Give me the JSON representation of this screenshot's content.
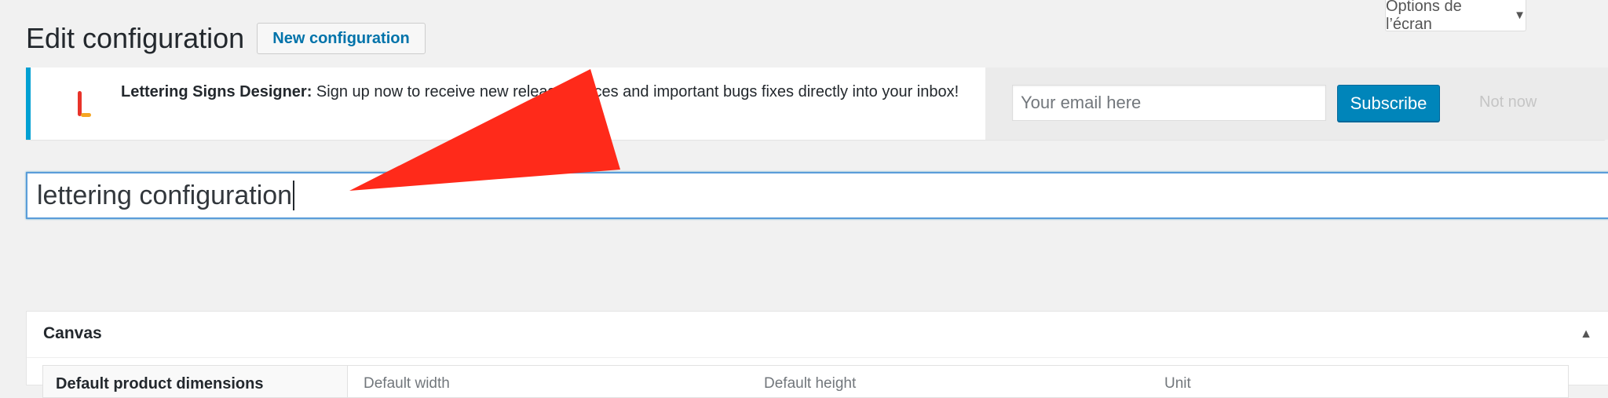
{
  "screen_options": {
    "label": "Options de l’écran",
    "arrow_icon": "triangle-down-icon"
  },
  "header": {
    "title": "Edit configuration",
    "new_button": "New configuration"
  },
  "notice": {
    "logo_icon": "lettering-logo",
    "product": "Lettering Signs Designer:",
    "message": " Sign up now to receive new release notices and important bugs fixes directly into your inbox!",
    "email_placeholder": "Your email here",
    "subscribe_label": "Subscribe",
    "dismiss_label": "Not now"
  },
  "title_field": {
    "value": "lettering configuration"
  },
  "canvas_box": {
    "title": "Canvas",
    "toggle_icon": "triangle-up-icon",
    "row_label": "Default product dimensions",
    "columns": [
      "Default width",
      "Default height",
      "Unit"
    ]
  },
  "colors": {
    "accent": "#0085ba",
    "notice_border": "#00a0d2",
    "arrow": "#ff2a1a"
  }
}
